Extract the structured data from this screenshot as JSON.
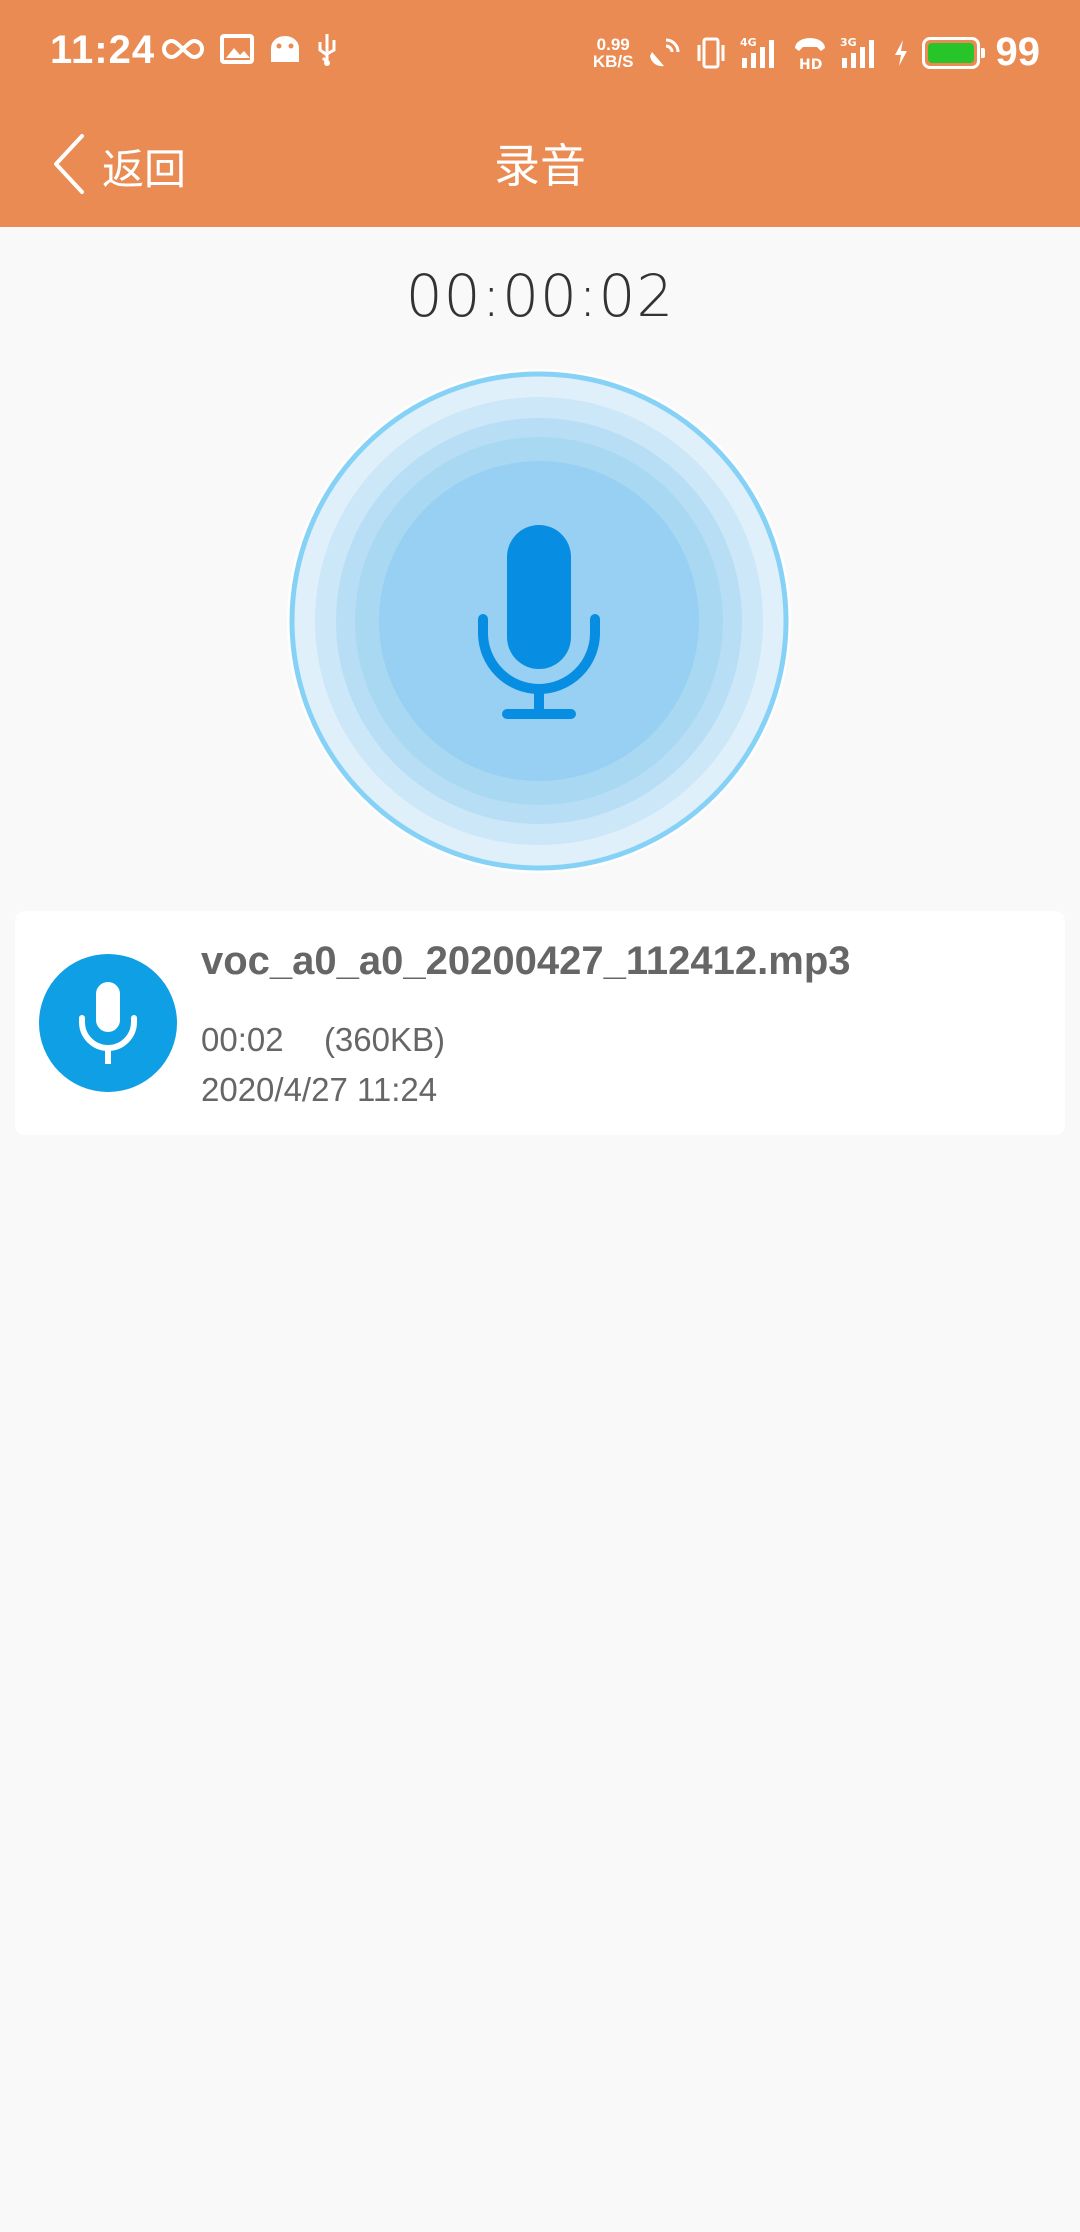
{
  "status_bar": {
    "time": "11:24",
    "net_speed_value": "0.99",
    "net_speed_unit": "KB/S",
    "signal_4g": "4G",
    "signal_3g": "3G",
    "hd": "HD",
    "battery_level": "99",
    "battery_color": "#27c52a"
  },
  "navbar": {
    "back_label": "返回",
    "title": "录音"
  },
  "recorder": {
    "elapsed": "00:00:02"
  },
  "recordings": [
    {
      "name": "voc_a0_a0_20200427_112412.mp3",
      "duration": "00:02",
      "size": "(360KB)",
      "date": "2020/4/27 11:24"
    }
  ],
  "colors": {
    "header": "#e98b52",
    "accent": "#0f9fe4"
  }
}
